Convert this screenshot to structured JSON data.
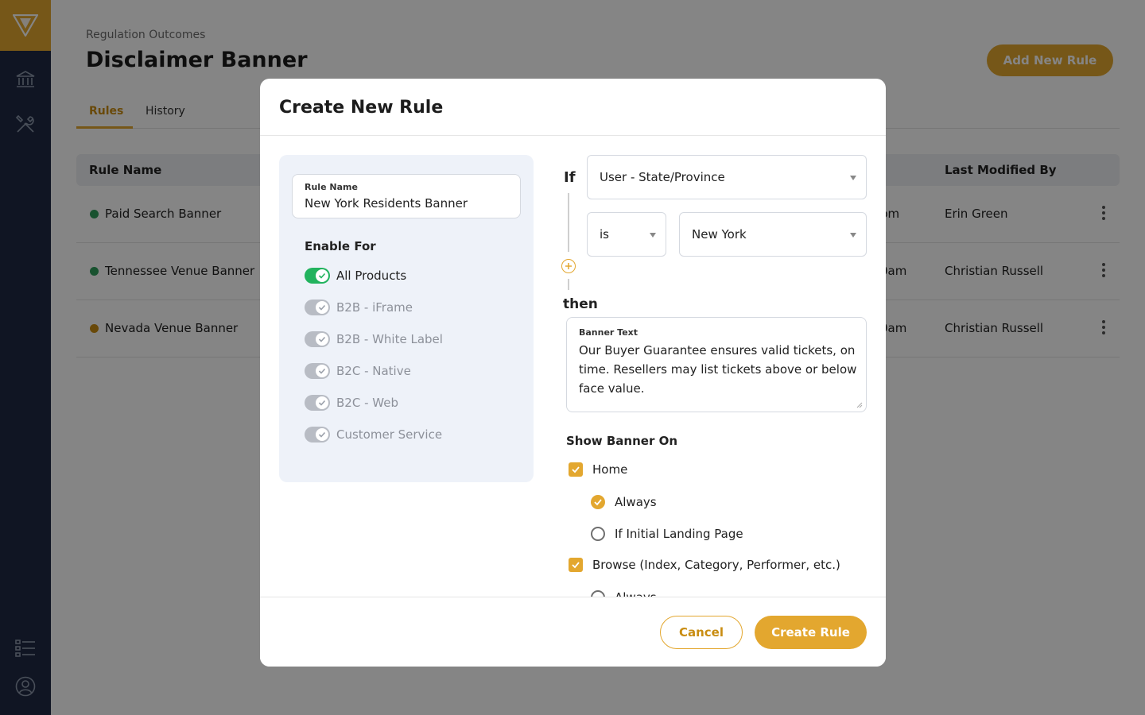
{
  "colors": {
    "accent": "#e3a72f",
    "sidebar": "#1f2a44",
    "toggle_on": "#22b35e",
    "toggle_off": "#b8bcc4",
    "status_active": "#2e9d5b",
    "status_pending": "#c98d12"
  },
  "sidebar": {
    "logo_icon": "triangle-logo-icon",
    "icons": [
      "bank-icon",
      "tools-icon",
      "list-icon",
      "user-icon"
    ]
  },
  "page": {
    "breadcrumb": "Regulation Outcomes",
    "title": "Disclaimer Banner",
    "add_button": "Add New Rule",
    "tabs": [
      {
        "label": "Rules",
        "active": true
      },
      {
        "label": "History",
        "active": false
      }
    ],
    "table": {
      "headers": {
        "rule_name": "Rule Name",
        "last_modified_by": "Last Modified By"
      },
      "rows": [
        {
          "name": "Paid Search Banner",
          "status": "active",
          "time_fragment": "pm",
          "modified_by": "Erin Green"
        },
        {
          "name": "Tennessee Venue Banner",
          "status": "active",
          "time_fragment": "0am",
          "modified_by": "Christian Russell"
        },
        {
          "name": "Nevada Venue Banner",
          "status": "pending",
          "time_fragment": "0am",
          "modified_by": "Christian Russell"
        }
      ]
    }
  },
  "modal": {
    "title": "Create New Rule",
    "rule_name": {
      "label": "Rule Name",
      "value": "New York Residents Banner"
    },
    "enable_for": {
      "title": "Enable For",
      "options": [
        {
          "label": "All Products",
          "enabled": true
        },
        {
          "label": "B2B - iFrame",
          "enabled": false
        },
        {
          "label": "B2B - White Label",
          "enabled": false
        },
        {
          "label": "B2C - Native",
          "enabled": false
        },
        {
          "label": "B2C - Web",
          "enabled": false
        },
        {
          "label": "Customer Service",
          "enabled": false
        }
      ]
    },
    "condition": {
      "if_label": "If",
      "attribute": "User - State/Province",
      "operator": "is",
      "value": "New York",
      "then_label": "then"
    },
    "banner_text": {
      "label": "Banner Text",
      "value": "Our Buyer Guarantee ensures valid tickets, on time. Resellers may list tickets above or below face value."
    },
    "show_banner_on": {
      "title": "Show Banner On",
      "home_label": "Home",
      "home_always": "Always",
      "home_initial": "If Initial Landing Page",
      "browse_label": "Browse (Index, Category, Performer, etc.)",
      "browse_always": "Always"
    },
    "cancel_button": "Cancel",
    "create_button": "Create Rule"
  }
}
